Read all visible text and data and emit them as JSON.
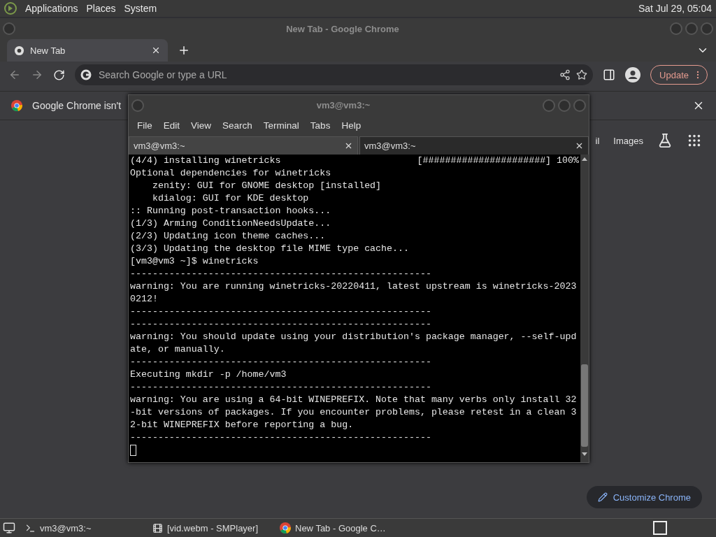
{
  "top_panel": {
    "menus": [
      "Applications",
      "Places",
      "System"
    ],
    "clock": "Sat Jul 29, 05:04"
  },
  "chrome": {
    "title": "New Tab - Google Chrome",
    "tabs": [
      {
        "label": "New Tab",
        "selected": true
      }
    ],
    "omnibox": {
      "placeholder": "Search Google or type a URL"
    },
    "update_button": "Update",
    "infobar": {
      "message": "Google Chrome isn't"
    },
    "ntp_links": [
      "il",
      "Images"
    ],
    "customize_button": "Customize Chrome"
  },
  "terminal": {
    "title": "vm3@vm3:~",
    "menus": [
      "File",
      "Edit",
      "View",
      "Search",
      "Terminal",
      "Tabs",
      "Help"
    ],
    "tabs": [
      {
        "label": "vm3@vm3:~",
        "selected": false
      },
      {
        "label": "vm3@vm3:~",
        "selected": true
      }
    ],
    "lines": [
      {
        "text": "(4/4) installing winetricks",
        "status": "[######################] 100%"
      },
      {
        "text": "Optional dependencies for winetricks"
      },
      {
        "text": "    zenity: GUI for GNOME desktop [installed]"
      },
      {
        "text": "    kdialog: GUI for KDE desktop"
      },
      {
        "text": ":: Running post-transaction hooks..."
      },
      {
        "text": "(1/3) Arming ConditionNeedsUpdate..."
      },
      {
        "text": "(2/3) Updating icon theme caches..."
      },
      {
        "text": "(3/3) Updating the desktop file MIME type cache..."
      },
      {
        "text": "[vm3@vm3 ~]$ winetricks"
      },
      {
        "text": "------------------------------------------------------"
      },
      {
        "text": "warning: You are running winetricks-20220411, latest upstream is winetricks-2023"
      },
      {
        "text": "0212!"
      },
      {
        "text": "------------------------------------------------------"
      },
      {
        "text": "------------------------------------------------------"
      },
      {
        "text": "warning: You should update using your distribution's package manager, --self-upd"
      },
      {
        "text": "ate, or manually."
      },
      {
        "text": "------------------------------------------------------"
      },
      {
        "text": "Executing mkdir -p /home/vm3"
      },
      {
        "text": "------------------------------------------------------"
      },
      {
        "text": "warning: You are using a 64-bit WINEPREFIX. Note that many verbs only install 32"
      },
      {
        "text": "-bit versions of packages. If you encounter problems, please retest in a clean 3"
      },
      {
        "text": "2-bit WINEPREFIX before reporting a bug."
      },
      {
        "text": "------------------------------------------------------"
      }
    ]
  },
  "taskbar": {
    "items": [
      {
        "label": "vm3@vm3:~",
        "kind": "terminal"
      },
      {
        "label": "[vid.webm - SMPlayer]",
        "kind": "player"
      },
      {
        "label": "New Tab - Google C…",
        "kind": "browser"
      }
    ]
  }
}
